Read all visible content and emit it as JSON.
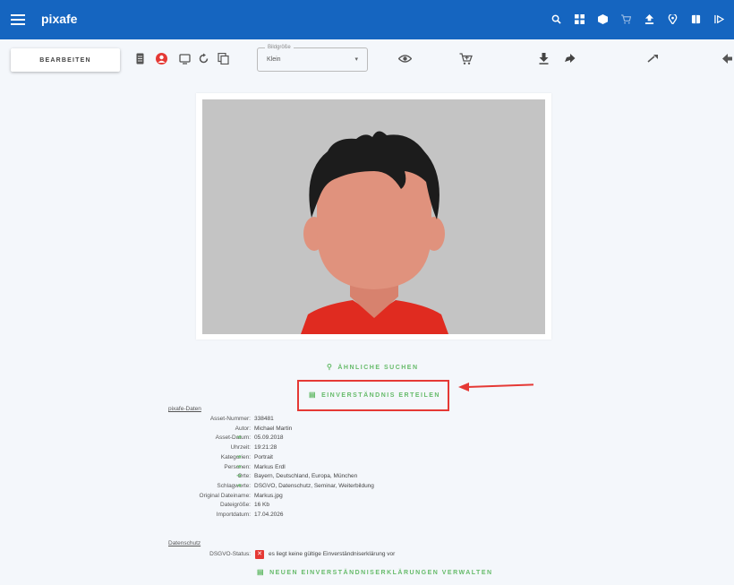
{
  "appbar": {
    "brand": "pixafe",
    "icons": [
      "search-icon",
      "grid-icon",
      "box-icon",
      "cart-icon",
      "upload-icon",
      "location-icon",
      "book-icon",
      "logout-icon"
    ]
  },
  "toolbar": {
    "edit_label": "BEARBEITEN",
    "size_legend": "Bildgröße",
    "size_value": "Klein",
    "size_caret": "▾"
  },
  "actions": {
    "similar_label": "ÄHNLICHE SUCHEN",
    "consent_label": "EINVERSTÄNDNIS ERTEILEN",
    "manage_label": "NEUEN EINVERSTÄNDNISERKLÄRUNGEN VERWALTEN"
  },
  "metadata": {
    "section_title": "pixafe-Daten",
    "rows": [
      {
        "label": "Asset-Nummer:",
        "value": "338481",
        "arrow": ""
      },
      {
        "label": "Autor:",
        "value": "Michael Martin",
        "arrow": ""
      },
      {
        "label": "Asset-Datum:",
        "value": "05.09.2018",
        "arrow": "➜"
      },
      {
        "label": "Uhrzeit:",
        "value": "19:21:28",
        "arrow": ""
      },
      {
        "label": "Kategorien:",
        "value": "Portrait",
        "arrow": "➜"
      },
      {
        "label": "Personen:",
        "value": "Markus Erdl",
        "arrow": "➜"
      },
      {
        "label": "Orte:",
        "value": "Bayern, Deutschland, Europa, München",
        "arrow": "➜"
      },
      {
        "label": "Schlagworte:",
        "value": "DSGVO, Datenschutz, Seminar, Weiterbildung",
        "arrow": "➜"
      },
      {
        "label": "Original Dateiname:",
        "value": "Markus.jpg",
        "arrow": ""
      },
      {
        "label": "Dateigröße:",
        "value": "16 Kb",
        "arrow": ""
      },
      {
        "label": "Importdatum:",
        "value": "17.04.2026",
        "arrow": ""
      }
    ],
    "privacy_title": "Datenschutz",
    "dsgvo_label": "DSGVO-Status:",
    "dsgvo_value": "es liegt keine gültige Einverständniserklärung vor",
    "dsgvo_icon_text": "✕"
  },
  "colors": {
    "appbar": "#1565c0",
    "accent_green": "#66bb6a",
    "highlight_red": "#e53935",
    "photo_bg": "#c4c4c4",
    "hair": "#1c1c1c",
    "skin": "#e0927d",
    "shirt": "#e02b20"
  }
}
